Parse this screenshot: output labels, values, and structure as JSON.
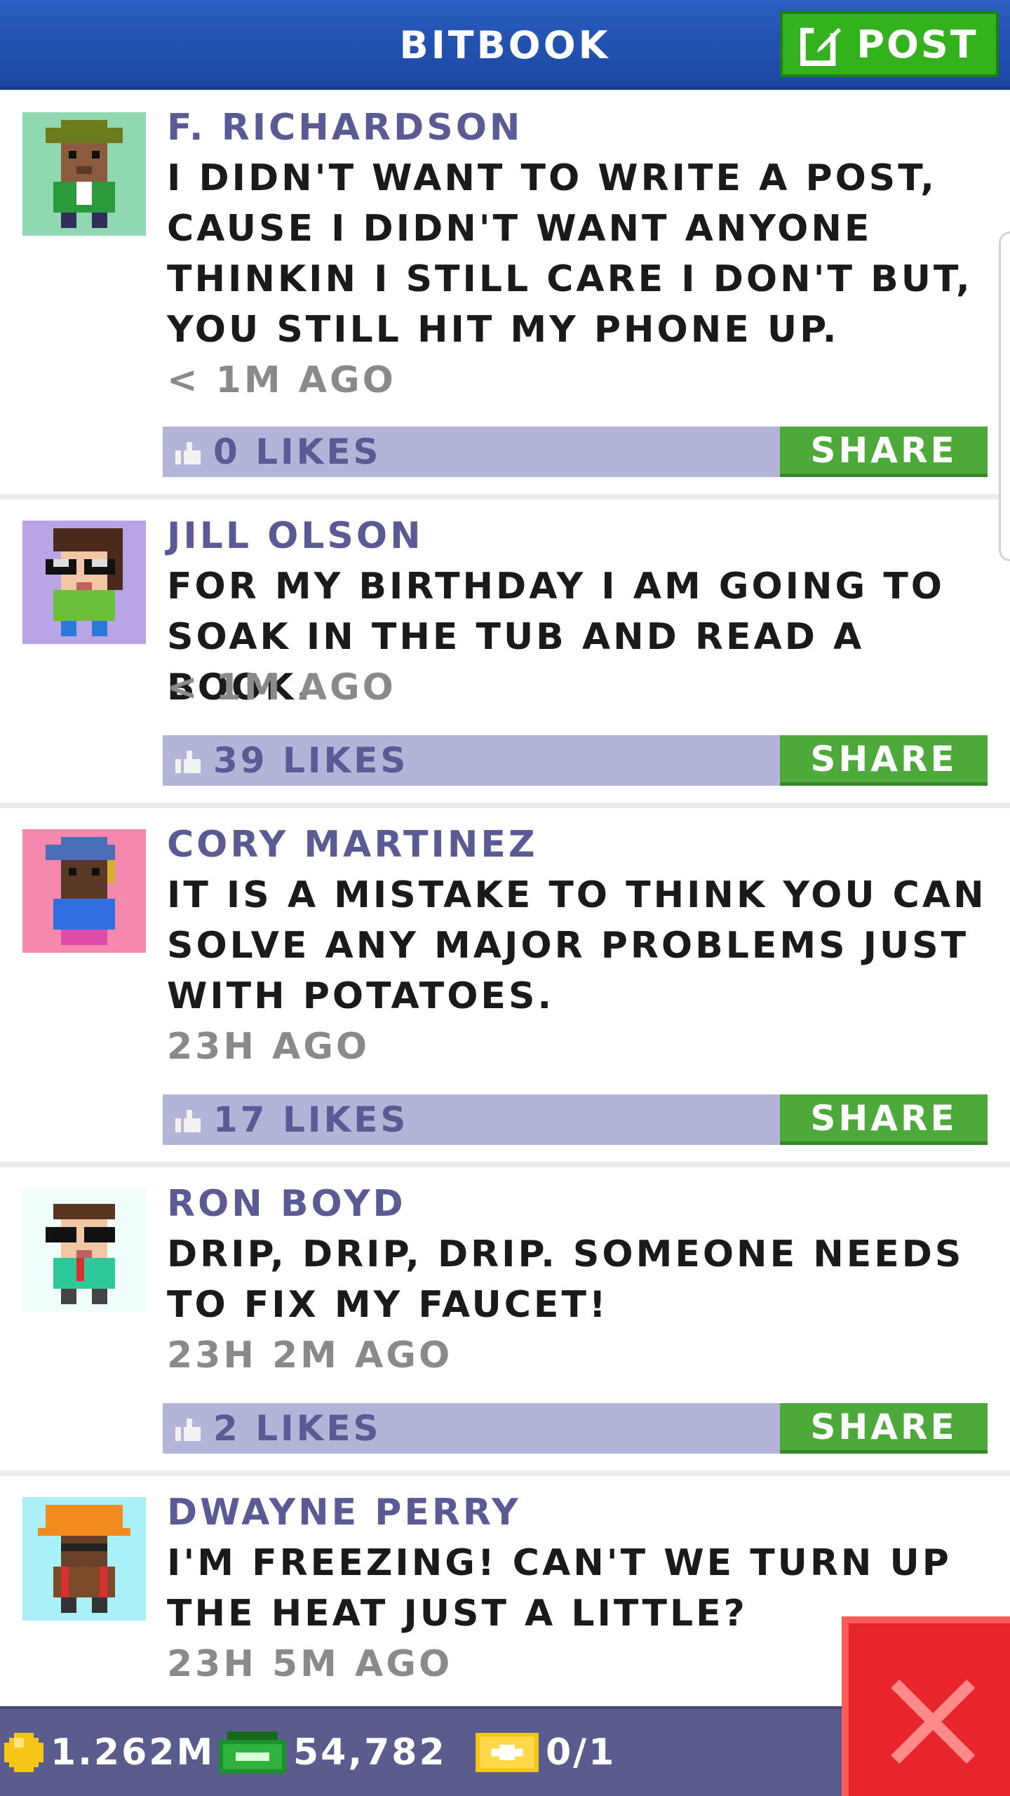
{
  "header": {
    "title": "BITBOOK",
    "post_label": "POST"
  },
  "posts": [
    {
      "author": "F. RICHARDSON",
      "text": "I DIDN'T WANT TO WRITE A POST, CAUSE I DIDN'T WANT ANYONE THINKIN I STILL CARE I DON'T BUT, YOU STILL HIT MY PHONE UP.",
      "time": "< 1M AGO",
      "likes": "0 LIKES",
      "share": "SHARE",
      "avatar_bg": "#8fd8b2"
    },
    {
      "author": "JILL OLSON",
      "text": "FOR MY BIRTHDAY I AM GOING TO SOAK IN THE TUB AND READ A BOOK.",
      "time": "< 1M AGO",
      "likes": "39 LIKES",
      "share": "SHARE",
      "avatar_bg": "#b9a4e6"
    },
    {
      "author": "CORY MARTINEZ",
      "text": "IT IS A MISTAKE TO THINK YOU CAN SOLVE ANY MAJOR PROBLEMS JUST WITH POTATOES.",
      "time": "23H AGO",
      "likes": "17 LIKES",
      "share": "SHARE",
      "avatar_bg": "#f489ad"
    },
    {
      "author": "RON BOYD",
      "text": "DRIP, DRIP, DRIP. SOMEONE NEEDS TO FIX MY FAUCET!",
      "time": "23H 2M AGO",
      "likes": "2 LIKES",
      "share": "SHARE",
      "avatar_bg": "#effdfb"
    },
    {
      "author": "DWAYNE PERRY",
      "text": "I'M FREEZING! CAN'T WE TURN UP THE HEAT JUST A LITTLE?",
      "time": "23H 5M AGO",
      "avatar_bg": "#a9f1f6"
    }
  ],
  "status_bar": {
    "coins": "1.262M",
    "bux": "54,782",
    "tickets": "0/1"
  },
  "icons": {
    "post": "edit-icon",
    "like": "thumbs-up-icon",
    "coin": "coin-icon",
    "bux": "bux-icon",
    "ticket": "ticket-icon",
    "close": "close-icon"
  },
  "colors": {
    "header": "#1b47a2",
    "accent_green": "#34b21e",
    "likes_bar": "#b3b5d8",
    "author": "#5a5a94",
    "close": "#e8252c"
  }
}
